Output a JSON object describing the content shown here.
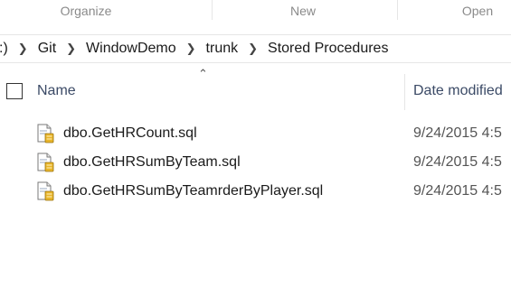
{
  "ribbon": {
    "groups": [
      "Organize",
      "New",
      "Open"
    ]
  },
  "address": {
    "crumbs": [
      ":)",
      "Git",
      "WindowDemo",
      "trunk",
      "Stored Procedures"
    ]
  },
  "columns": {
    "name": "Name",
    "date": "Date modified"
  },
  "files": [
    {
      "name": "dbo.GetHRCount.sql",
      "date": "9/24/2015 4:5"
    },
    {
      "name": "dbo.GetHRSumByTeam.sql",
      "date": "9/24/2015 4:5"
    },
    {
      "name": "dbo.GetHRSumByTeamrderByPlayer.sql",
      "date": "9/24/2015 4:5"
    }
  ]
}
